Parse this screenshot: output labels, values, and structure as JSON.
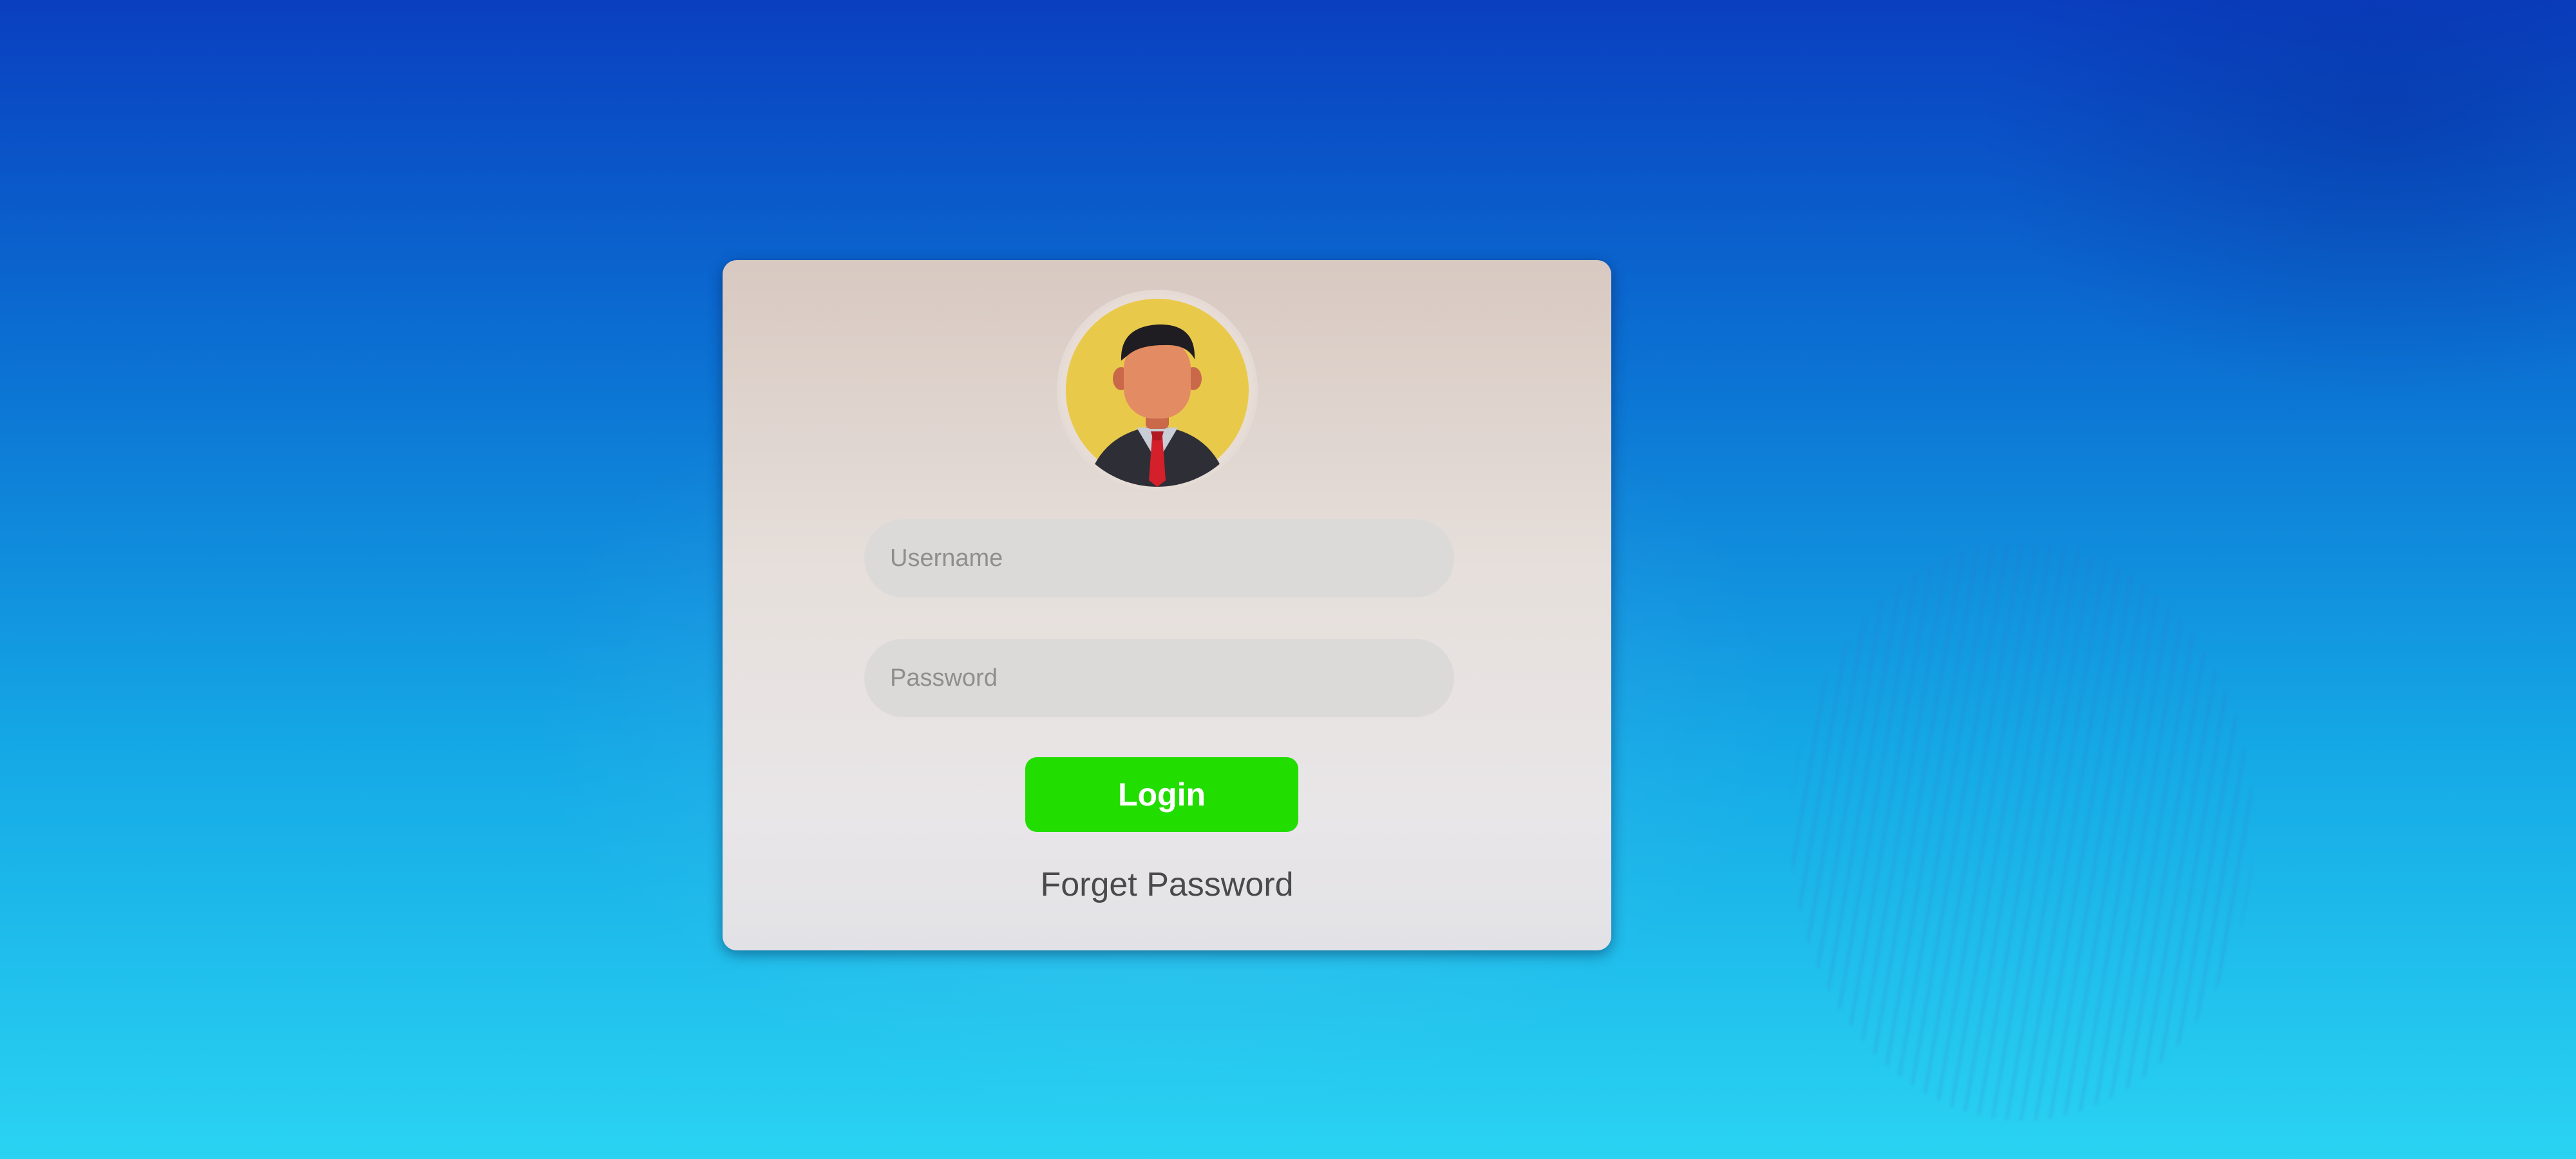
{
  "login_form": {
    "avatar_icon": "businessman-avatar-icon",
    "username_placeholder": "Username",
    "password_placeholder": "Password",
    "login_label": "Login",
    "forgot_password_label": "Forget Password"
  },
  "colors": {
    "login_button": "#22dd00",
    "avatar_background": "#e9c94a",
    "desktop_top": "#0a3fc0",
    "desktop_bottom": "#2ad3f2"
  }
}
